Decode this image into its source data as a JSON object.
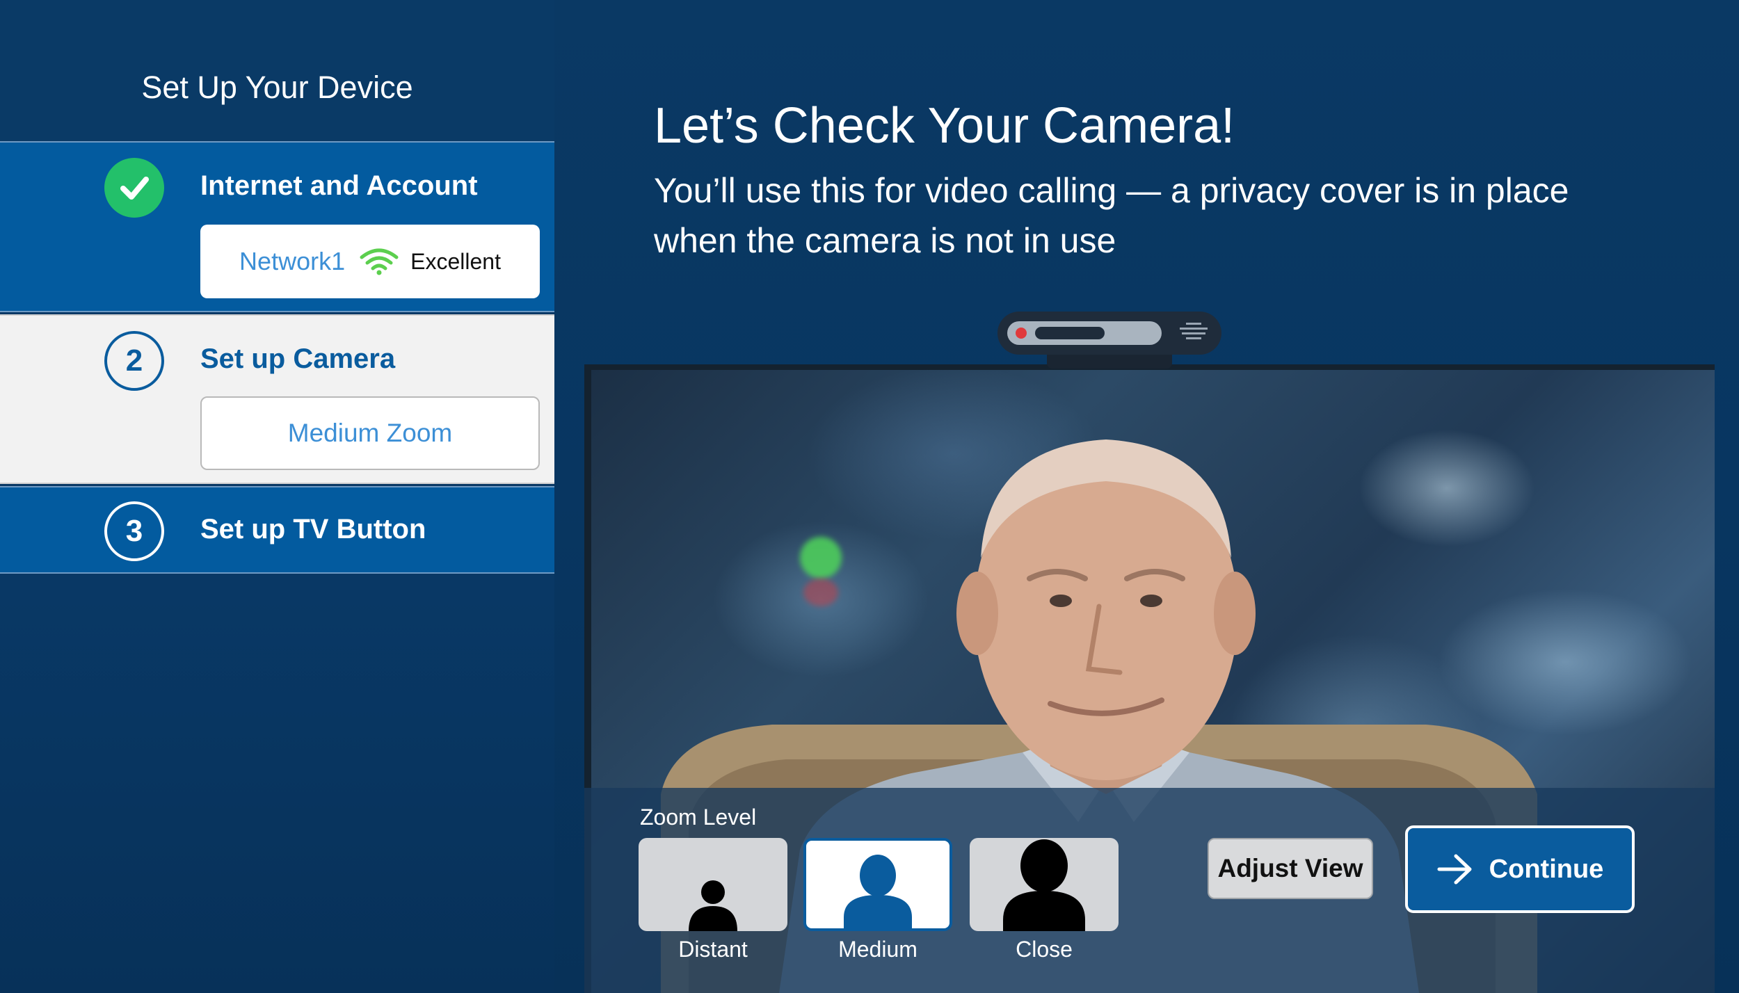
{
  "sidebar": {
    "title": "Set Up Your Device",
    "steps": [
      {
        "state": "done",
        "badge_icon": "check-icon",
        "label": "Internet and Account",
        "card": {
          "network_name": "Network1",
          "signal_icon": "wifi-icon",
          "signal_quality": "Excellent"
        }
      },
      {
        "state": "current",
        "number": "2",
        "label": "Set up Camera",
        "card": {
          "zoom_value": "Medium Zoom"
        }
      },
      {
        "state": "upcoming",
        "number": "3",
        "label": "Set up TV Button"
      }
    ]
  },
  "main": {
    "title": "Let’s Check Your Camera!",
    "subtitle": "You’ll use this for video calling — a privacy cover is in place when the camera is not in use"
  },
  "controls": {
    "zoom_label": "Zoom Level",
    "zoom_options": [
      {
        "label": "Distant",
        "icon": "person-distant-icon",
        "selected": false
      },
      {
        "label": "Medium",
        "icon": "person-medium-icon",
        "selected": true
      },
      {
        "label": "Close",
        "icon": "person-close-icon",
        "selected": false
      }
    ],
    "adjust_label": "Adjust View",
    "continue_label": "Continue",
    "continue_icon": "arrow-right-icon"
  },
  "colors": {
    "background": "#083661",
    "sidebar_active_blue": "#035b9f",
    "current_step_bg": "#f2f2f2",
    "check_green": "#23c06a",
    "wifi_green": "#5ccf4e",
    "link_blue": "#3c8fd6",
    "camera_led_red": "#e0393b"
  }
}
